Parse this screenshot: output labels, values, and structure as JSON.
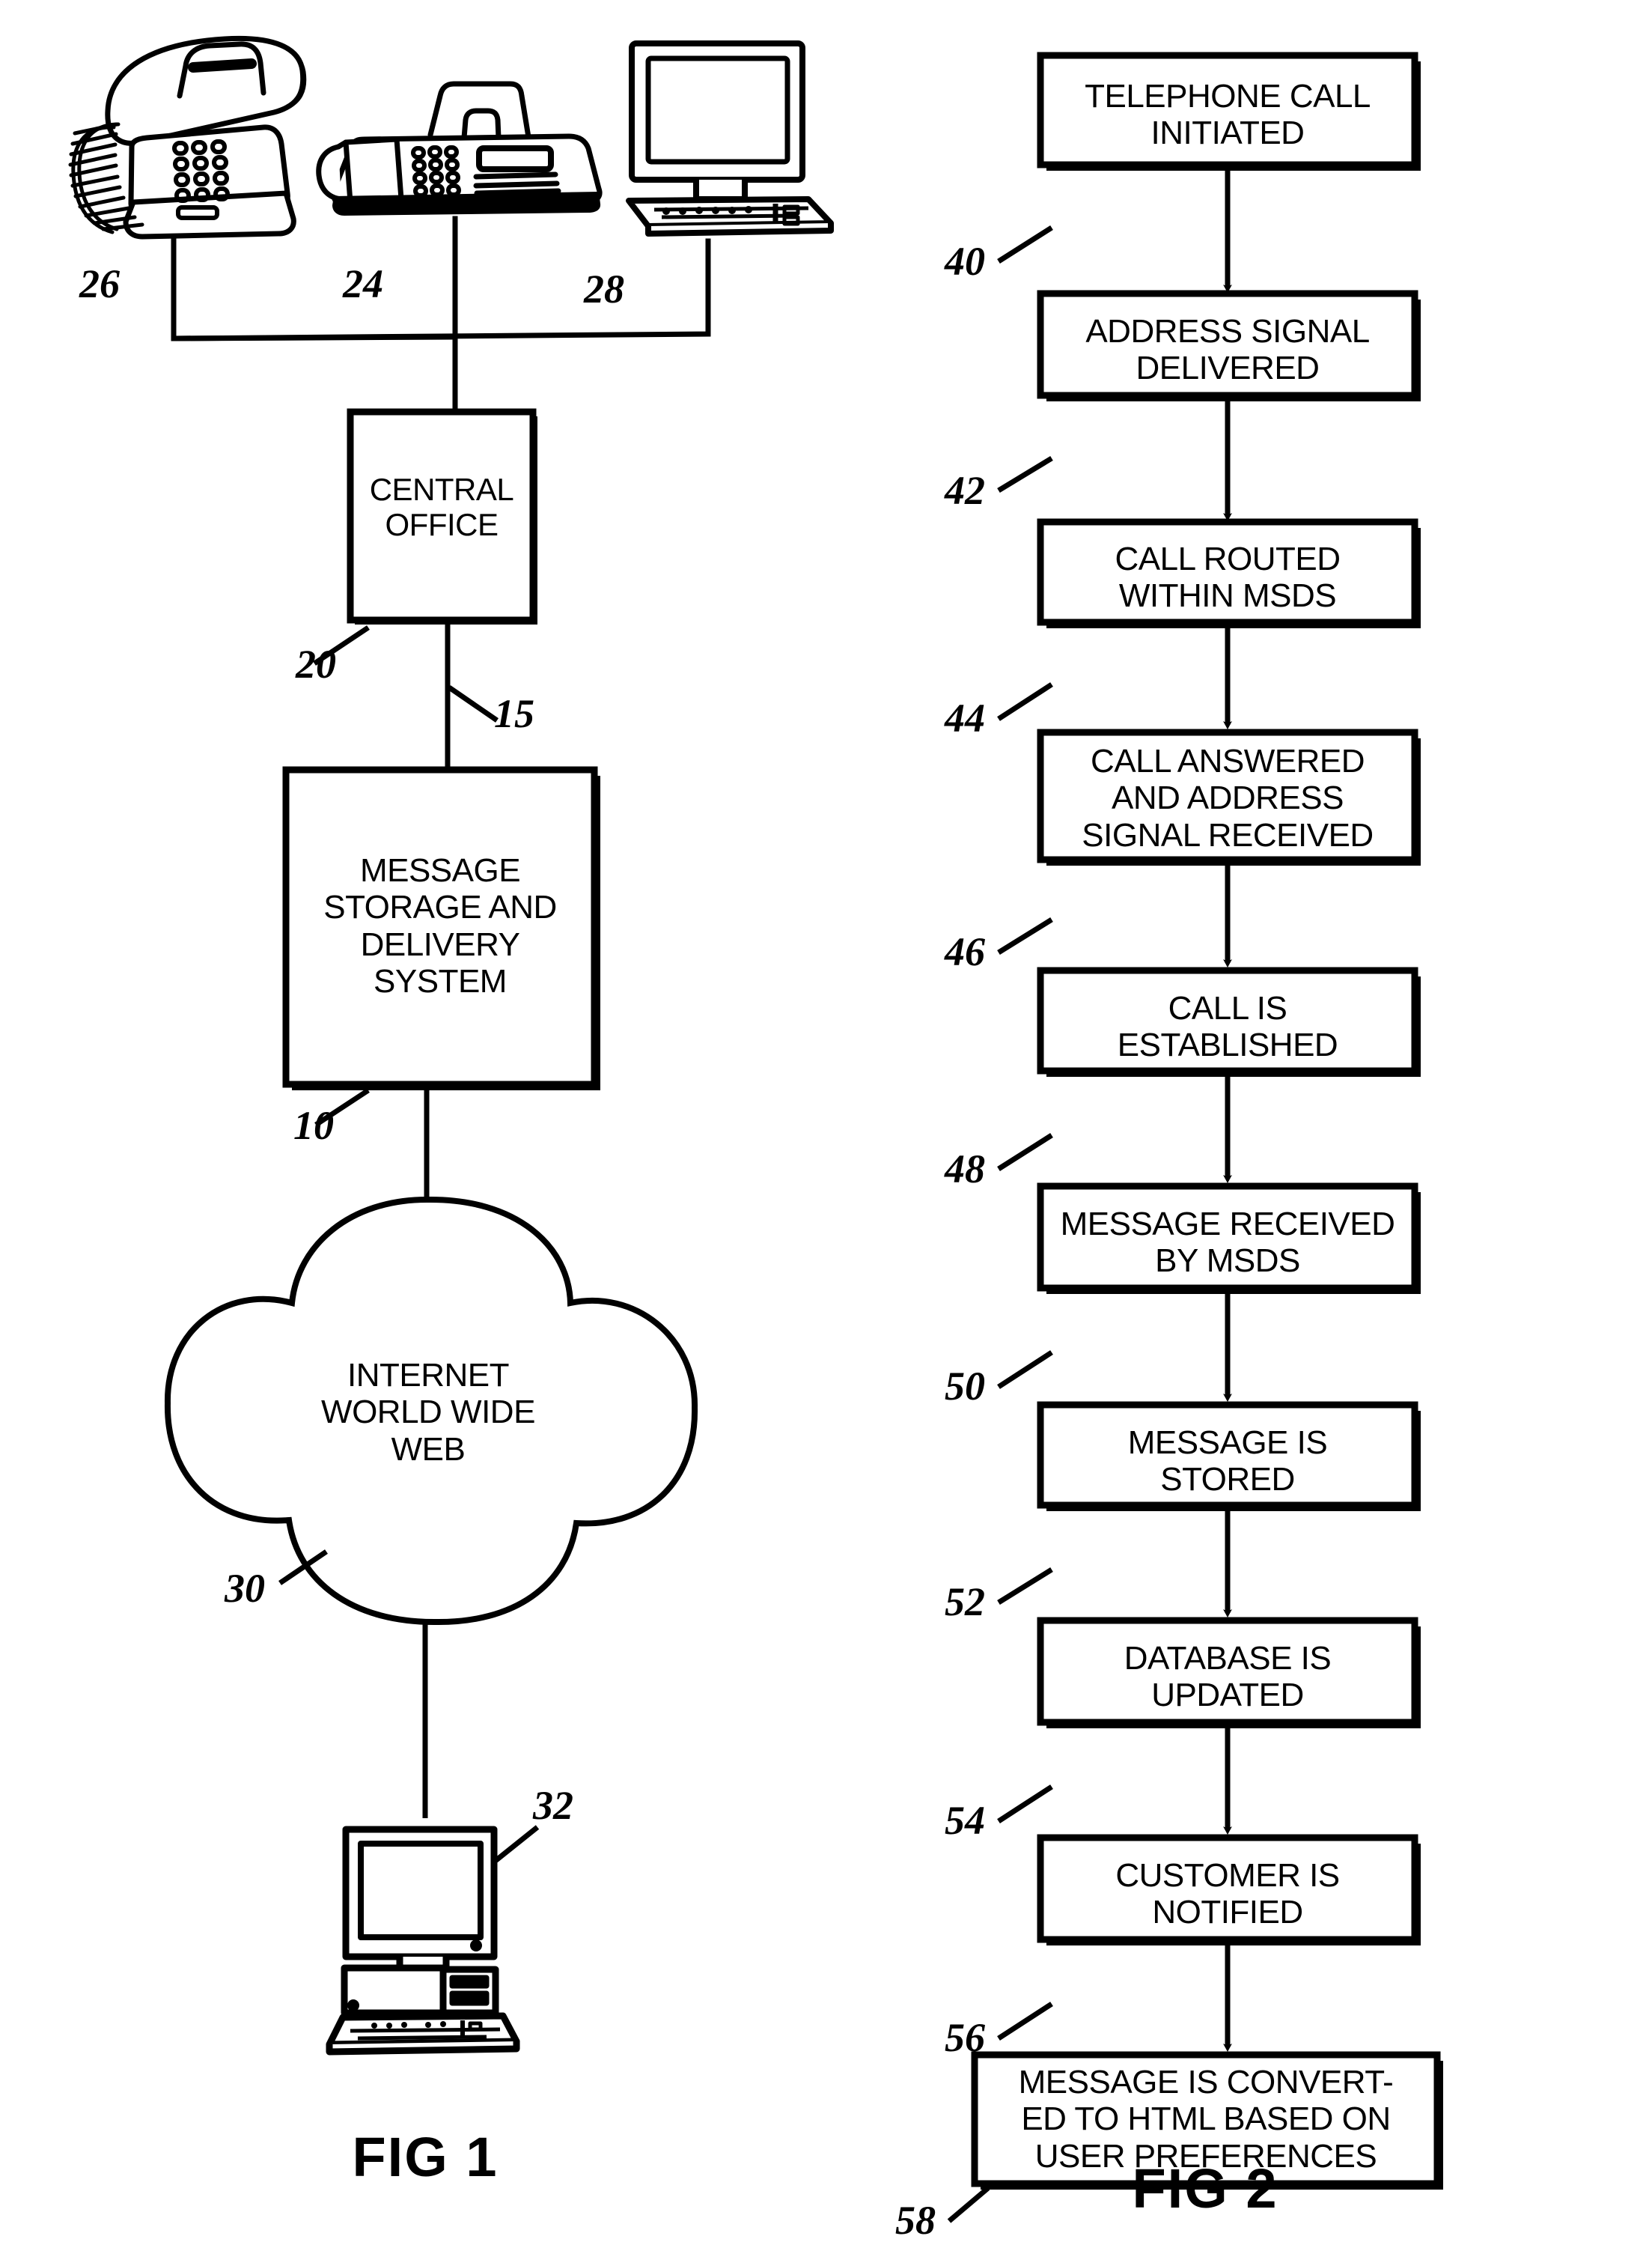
{
  "figure1": {
    "title": "FIG 1",
    "devices": [
      {
        "name": "telephone",
        "ref": "26"
      },
      {
        "name": "fax-machine",
        "ref": "24"
      },
      {
        "name": "computer-terminal",
        "ref": "28"
      }
    ],
    "boxes": [
      {
        "id": "central-office",
        "text": "CENTRAL\nOFFICE",
        "ref": "20"
      },
      {
        "id": "msds",
        "text": "MESSAGE\nSTORAGE AND\nDELIVERY\nSYSTEM",
        "ref": "10"
      }
    ],
    "link_ref": "15",
    "cloud": {
      "text": "INTERNET\nWORLD WIDE\nWEB",
      "ref": "30"
    },
    "client_computer": {
      "ref": "32"
    }
  },
  "figure2": {
    "title": "FIG 2",
    "steps": [
      {
        "text": "TELEPHONE CALL\nINITIATED",
        "ref": "40"
      },
      {
        "text": "ADDRESS SIGNAL\nDELIVERED",
        "ref": "42"
      },
      {
        "text": "CALL ROUTED\nWITHIN MSDS",
        "ref": "44"
      },
      {
        "text": "CALL ANSWERED\nAND ADDRESS\nSIGNAL RECEIVED",
        "ref": "46"
      },
      {
        "text": "CALL IS\nESTABLISHED",
        "ref": "48"
      },
      {
        "text": "MESSAGE RECEIVED\nBY MSDS",
        "ref": "50"
      },
      {
        "text": "MESSAGE IS\nSTORED",
        "ref": "52"
      },
      {
        "text": "DATABASE IS\nUPDATED",
        "ref": "54"
      },
      {
        "text": "CUSTOMER IS\nNOTIFIED",
        "ref": "56"
      },
      {
        "text": "MESSAGE IS CONVERT-\nED TO HTML BASED ON\nUSER PREFERENCES",
        "ref": "58"
      }
    ]
  },
  "colors": {
    "ink": "#000000",
    "paper": "#ffffff"
  }
}
